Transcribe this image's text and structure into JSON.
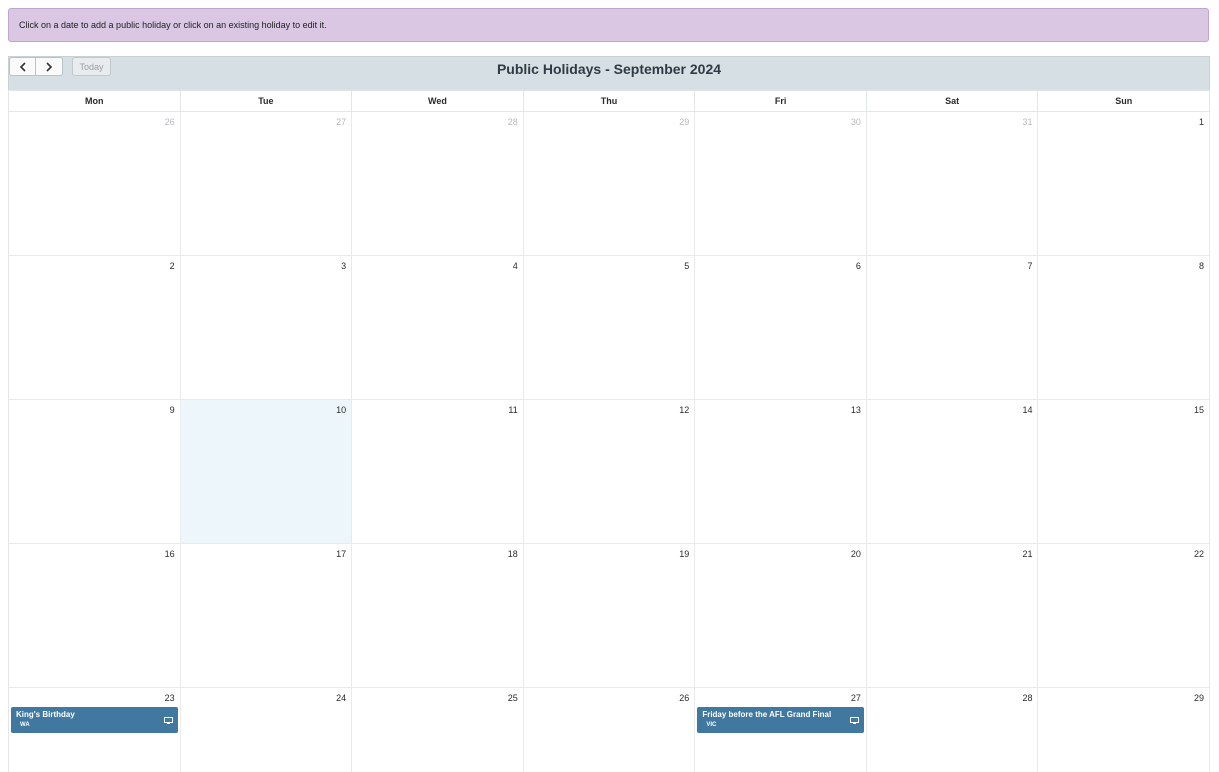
{
  "notice": "Click on a date to add a public holiday or click on an existing holiday to edit it.",
  "toolbar": {
    "prev_glyph": "‹",
    "next_glyph": "›",
    "today_label": "Today",
    "title": "Public Holidays - September 2024"
  },
  "weekdays": [
    "Mon",
    "Tue",
    "Wed",
    "Thu",
    "Fri",
    "Sat",
    "Sun"
  ],
  "weeks": [
    [
      {
        "day": "26",
        "other": true
      },
      {
        "day": "27",
        "other": true
      },
      {
        "day": "28",
        "other": true
      },
      {
        "day": "29",
        "other": true
      },
      {
        "day": "30",
        "other": true
      },
      {
        "day": "31",
        "other": true
      },
      {
        "day": "1",
        "other": false
      }
    ],
    [
      {
        "day": "2"
      },
      {
        "day": "3"
      },
      {
        "day": "4"
      },
      {
        "day": "5"
      },
      {
        "day": "6"
      },
      {
        "day": "7"
      },
      {
        "day": "8"
      }
    ],
    [
      {
        "day": "9"
      },
      {
        "day": "10",
        "today": true
      },
      {
        "day": "11"
      },
      {
        "day": "12"
      },
      {
        "day": "13"
      },
      {
        "day": "14"
      },
      {
        "day": "15"
      }
    ],
    [
      {
        "day": "16"
      },
      {
        "day": "17"
      },
      {
        "day": "18"
      },
      {
        "day": "19"
      },
      {
        "day": "20"
      },
      {
        "day": "21"
      },
      {
        "day": "22"
      }
    ],
    [
      {
        "day": "23",
        "event": {
          "title": "King's Birthday",
          "state": "WA",
          "icon": "monitor-icon"
        }
      },
      {
        "day": "24"
      },
      {
        "day": "25"
      },
      {
        "day": "26"
      },
      {
        "day": "27",
        "event": {
          "title": "Friday before the AFL Grand Final",
          "state": "VIC",
          "icon": "monitor-icon"
        }
      },
      {
        "day": "28"
      },
      {
        "day": "29"
      }
    ]
  ],
  "colors": {
    "notice_bg": "#d9c7e4",
    "toolbar_bg": "#d6dfe3",
    "today_bg": "#edf7fb",
    "event_bg": "#41789f"
  }
}
